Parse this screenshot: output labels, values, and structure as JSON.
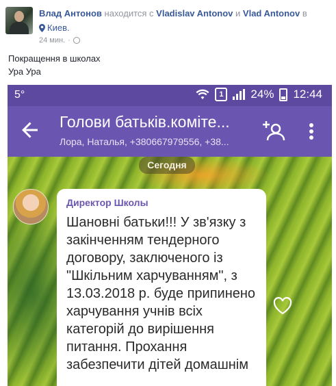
{
  "post": {
    "author": "Влад Антонов",
    "verb": "находится с",
    "tagged1": "Vladislav Antonov",
    "conj": "и",
    "tagged2": "Vlad Antonov",
    "prep": "в",
    "location": "Киев.",
    "time": "24 мин.",
    "separator": "·",
    "text_line1": "Покращення в школах",
    "text_line2": "Ура Ура"
  },
  "screenshot": {
    "status_left": "5°",
    "sim_badge": "1",
    "battery_text": "24%",
    "clock": "12:44",
    "chat_title": "Голови батьків.коміте...",
    "chat_subtitle": "Лора, Наталья, +380667979556, +38...",
    "date_label": "Сегодня",
    "sender_name": "Директор Школы",
    "message": "Шановні батьки!!! У зв'язку з закінченням тендерного договору,  заключеного із \"Шкільним харчуванням\", з 13.03.2018 р. буде припинено харчування учнів всіх категорій до вирішення питання. Прохання забезпечити дітей домашнім"
  },
  "colors": {
    "facebook_link": "#385898",
    "viber_purple": "#6a55b0"
  }
}
